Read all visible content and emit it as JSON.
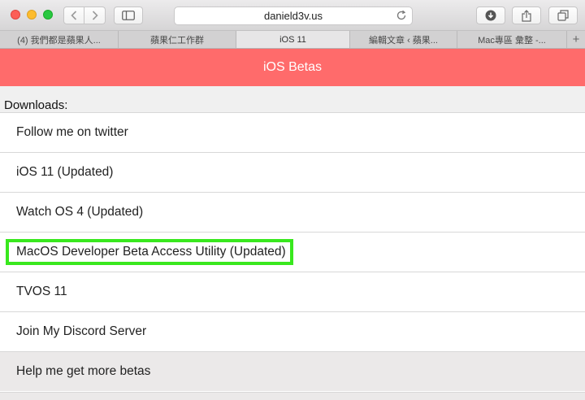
{
  "browser": {
    "url": "danield3v.us",
    "tabs": [
      {
        "label": "(4) 我們都是蘋果人..."
      },
      {
        "label": "蘋果仁工作群"
      },
      {
        "label": "iOS 11",
        "active": true
      },
      {
        "label": "編輯文章 ‹ 蘋果..."
      },
      {
        "label": "Mac專區 彙整 -..."
      }
    ],
    "new_tab_label": "+"
  },
  "page": {
    "banner_title": "iOS Betas",
    "section_label": "Downloads:",
    "items": [
      {
        "label": "Follow me on twitter"
      },
      {
        "label": "iOS 11 (Updated)"
      },
      {
        "label": "Watch OS 4 (Updated)"
      },
      {
        "label": "MacOS Developer Beta Access Utility (Updated)",
        "highlighted": true
      },
      {
        "label": "TVOS 11"
      },
      {
        "label": "Join My Discord Server"
      }
    ],
    "footer_item": "Help me get more betas"
  },
  "colors": {
    "banner": "#ff6b6b",
    "highlight_border": "#39e81e"
  }
}
